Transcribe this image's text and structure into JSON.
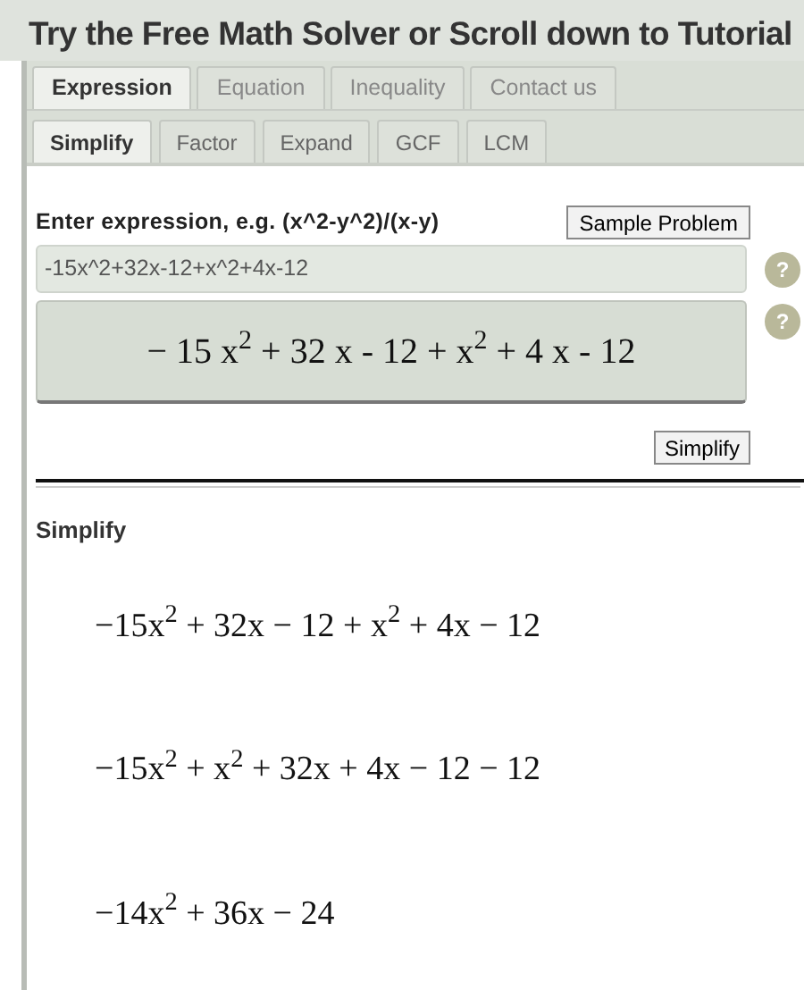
{
  "title": "Try the Free Math Solver or Scroll down to Tutorial",
  "tabs": [
    {
      "label": "Expression",
      "selected": true
    },
    {
      "label": "Equation",
      "selected": false
    },
    {
      "label": "Inequality",
      "selected": false
    },
    {
      "label": "Contact us",
      "selected": false
    }
  ],
  "subtabs": [
    {
      "label": "Simplify",
      "selected": true
    },
    {
      "label": "Factor",
      "selected": false
    },
    {
      "label": "Expand",
      "selected": false
    },
    {
      "label": "GCF",
      "selected": false
    },
    {
      "label": "LCM",
      "selected": false
    }
  ],
  "input": {
    "label": "Enter expression, e.g. (x^2-y^2)/(x-y)",
    "sample_button": "Sample Problem",
    "value": "-15x^2+32x-12+x^2+4x-12",
    "help": "?"
  },
  "preview": {
    "text": "− 15 x$^{2}$ + 32 x - 12 + x$^{2}$ + 4 x - 12",
    "help": "?"
  },
  "action_button": "Simplify",
  "result": {
    "heading": "Simplify",
    "steps": [
      "−15x$^{2}$ + 32x − 12 + x$^{2}$ + 4x − 12",
      "−15x$^{2}$ + x$^{2}$ + 32x + 4x − 12 − 12",
      "−14x$^{2}$ + 36x − 24"
    ]
  }
}
